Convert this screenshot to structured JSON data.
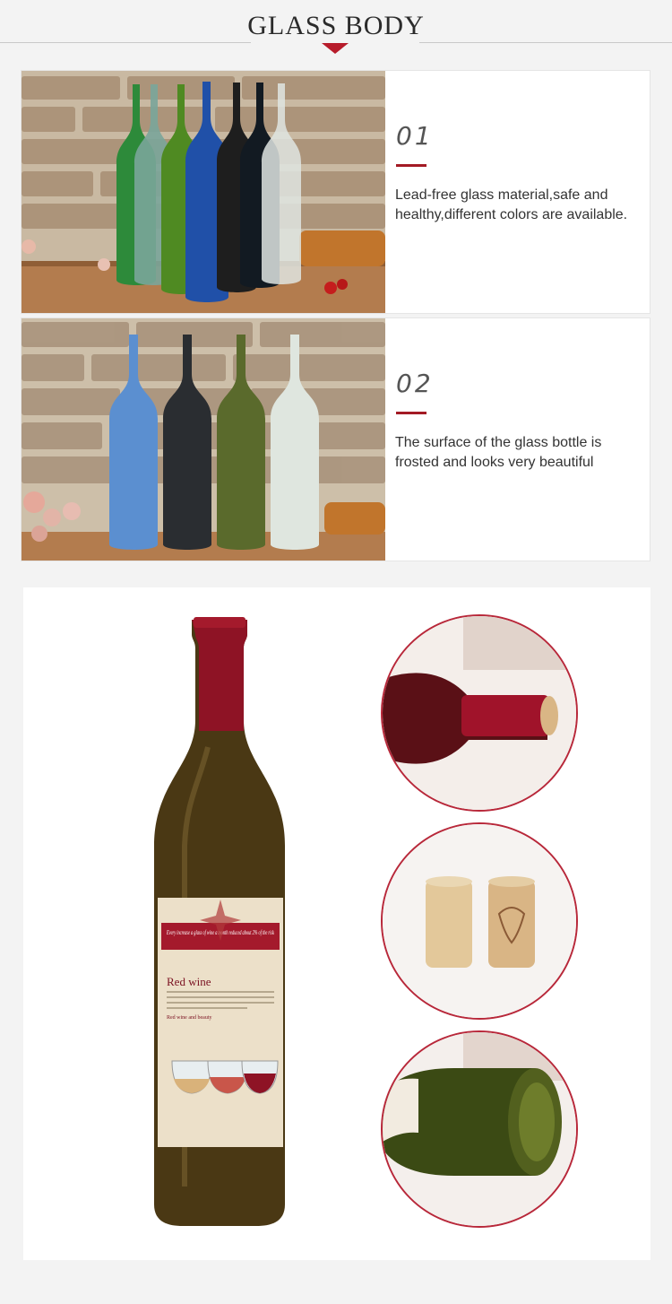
{
  "header": {
    "title": "GLASS BODY"
  },
  "features": [
    {
      "number": "01",
      "description": "Lead-free glass material,safe and healthy,different colors are available."
    },
    {
      "number": "02",
      "description": "The surface of the glass bottle is frosted and looks very beautiful"
    }
  ],
  "label": {
    "banner_text": "Every increase a glass of wine a month reduced about 2% of the risk",
    "title": "Red wine",
    "subtitle": "Red wine and beauty"
  },
  "colors": {
    "accent": "#a31a24",
    "background": "#f3f3f3",
    "card": "#ffffff"
  }
}
